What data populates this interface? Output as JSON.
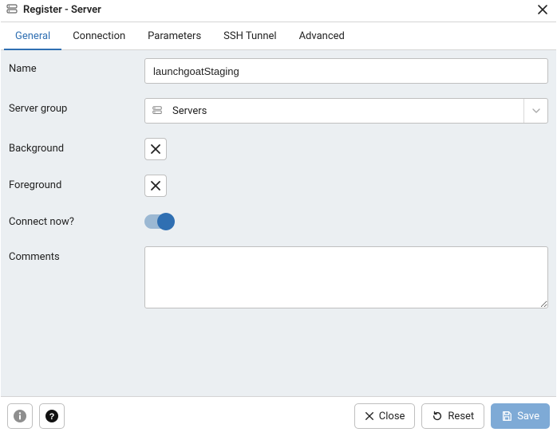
{
  "window": {
    "title": "Register - Server"
  },
  "tabs": [
    {
      "label": "General",
      "active": true
    },
    {
      "label": "Connection",
      "active": false
    },
    {
      "label": "Parameters",
      "active": false
    },
    {
      "label": "SSH Tunnel",
      "active": false
    },
    {
      "label": "Advanced",
      "active": false
    }
  ],
  "form": {
    "name_label": "Name",
    "name_value": "launchgoatStaging",
    "group_label": "Server group",
    "group_value": "Servers",
    "background_label": "Background",
    "foreground_label": "Foreground",
    "connect_label": "Connect now?",
    "connect_on": true,
    "comments_label": "Comments",
    "comments_value": ""
  },
  "footer": {
    "close_label": "Close",
    "reset_label": "Reset",
    "save_label": "Save"
  }
}
